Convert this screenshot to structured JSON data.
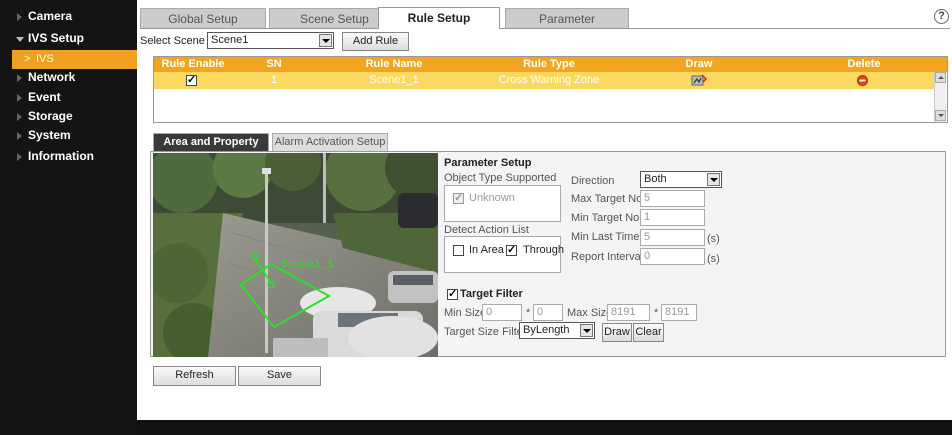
{
  "sidebar": {
    "items": [
      {
        "label": "Camera"
      },
      {
        "label": "IVS Setup"
      },
      {
        "label": "Network"
      },
      {
        "label": "Event"
      },
      {
        "label": "Storage"
      },
      {
        "label": "System"
      },
      {
        "label": "Information"
      }
    ],
    "sub_item": {
      "label": "IVS",
      "arrow": ">"
    }
  },
  "tabs": [
    {
      "label": "Global Setup"
    },
    {
      "label": "Scene Setup"
    },
    {
      "label": "Rule Setup"
    },
    {
      "label": "Parameter"
    }
  ],
  "help_icon": "?",
  "scene": {
    "label": "Select Scene",
    "value": "Scene1",
    "add_rule": "Add Rule"
  },
  "rule_table": {
    "headers": [
      "Rule Enable",
      "SN",
      "Rule Name",
      "Rule Type",
      "Draw",
      "Delete"
    ],
    "rows": [
      {
        "enabled": true,
        "sn": "1",
        "name": "Scene1_1",
        "type": "Cross Warning Zone"
      }
    ]
  },
  "subtabs": [
    {
      "label": "Area and Property Setup"
    },
    {
      "label": "Alarm Activation Setup"
    }
  ],
  "video": {
    "overlay_label": "Scene1_1"
  },
  "params": {
    "title": "Parameter Setup",
    "object_type_label": "Object Type Supported",
    "object_type_option": "Unknown",
    "detect_action_label": "Detect Action List",
    "in_area_label": "In Area",
    "through_label": "Through",
    "direction_label": "Direction",
    "direction_value": "Both",
    "max_target_label": "Max Target No.",
    "max_target_value": "5",
    "min_target_label": "Min Target No.",
    "min_target_value": "1",
    "min_last_time_label": "Min Last Time",
    "min_last_time_value": "5",
    "report_interval_label": "Report Interval",
    "report_interval_value": "0",
    "seconds_unit": "(s)"
  },
  "target_filter": {
    "label": "Target Filter",
    "min_size_label": "Min Size",
    "min_w": "0",
    "min_h": "0",
    "max_size_label": "Max Size",
    "max_w": "8191",
    "max_h": "8191",
    "times": "*",
    "size_filter_label": "Target Size Filter",
    "size_filter_value": "ByLength",
    "draw": "Draw",
    "clear": "Clear"
  },
  "actions": {
    "refresh": "Refresh",
    "save": "Save"
  },
  "colors": {
    "accent": "#F4A520",
    "row_highlight": "#FBD960",
    "sidebar_sub": "#F0A020",
    "overlay_line": "#2BE02B"
  }
}
